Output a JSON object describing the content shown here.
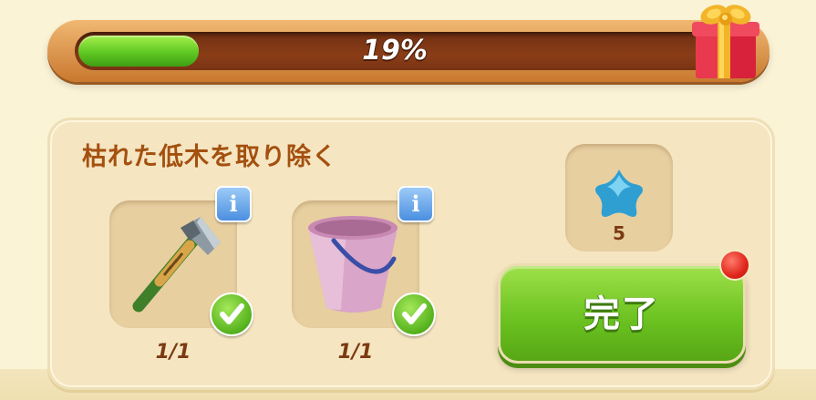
{
  "progress": {
    "percent_text": "19%",
    "value": 0.19,
    "colors": {
      "fill": "#5fc722",
      "track": "#7a3413",
      "frame": "#d98d42"
    }
  },
  "gift_icon": "gift-box-icon",
  "task": {
    "title": "枯れた低木を取り除く",
    "items": [
      {
        "icon": "axe-icon",
        "count": "1/1",
        "info_label": "i",
        "completed": true
      },
      {
        "icon": "bucket-icon",
        "count": "1/1",
        "info_label": "i",
        "completed": true
      }
    ]
  },
  "reward": {
    "icon": "blue-star-icon",
    "amount": "5"
  },
  "complete_button": {
    "label": "完了",
    "accent": "#6cc321"
  }
}
